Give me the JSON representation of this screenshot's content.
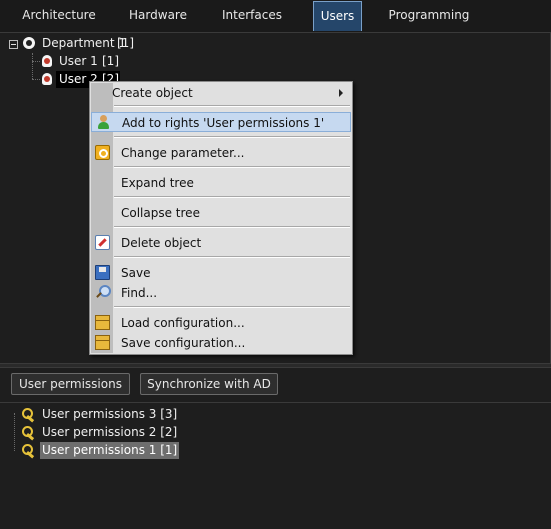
{
  "tabs": [
    {
      "label": "Architecture"
    },
    {
      "label": "Hardware"
    },
    {
      "label": "Interfaces"
    },
    {
      "label": "Users",
      "active": true
    },
    {
      "label": "Programming"
    }
  ],
  "tree": {
    "department": {
      "label": "Department 1",
      "count": "[1]",
      "icon": "department-icon"
    },
    "users": [
      {
        "label": "User 1",
        "count": "[1]",
        "icon": "user-icon"
      },
      {
        "label": "User 2",
        "count": "[2]",
        "icon": "user-icon",
        "selected": true
      }
    ]
  },
  "context_menu": {
    "items": [
      {
        "label": "Create object",
        "icon": "",
        "submenu": true
      },
      {
        "label": "Add to rights 'User permissions 1'",
        "icon": "user-add-icon",
        "highlighted": true
      },
      {
        "label": "Change parameter...",
        "icon": "parameter-icon"
      },
      {
        "label": "Expand tree",
        "icon": ""
      },
      {
        "label": "Collapse tree",
        "icon": ""
      },
      {
        "label": "Delete object",
        "icon": "delete-icon"
      },
      {
        "label": "Save",
        "icon": "save-icon"
      },
      {
        "label": "Find...",
        "icon": "find-icon"
      },
      {
        "label": "Load configuration...",
        "icon": "box-icon"
      },
      {
        "label": "Save configuration...",
        "icon": "box-icon"
      }
    ]
  },
  "buttons": {
    "user_permissions": "User permissions",
    "synchronize": "Synchronize with AD"
  },
  "permissions": [
    {
      "label": "User permissions 3 [3]",
      "icon": "key-icon"
    },
    {
      "label": "User permissions 2 [2]",
      "icon": "key-icon"
    },
    {
      "label": "User permissions 1 [1]",
      "icon": "key-icon",
      "selected": true
    }
  ],
  "colors": {
    "background": "#1e1e1e",
    "active_tab": "#25466a",
    "menu_background": "#e0e0e0",
    "menu_highlight": "#c6d9f0",
    "selection": "#6e6e6e"
  }
}
